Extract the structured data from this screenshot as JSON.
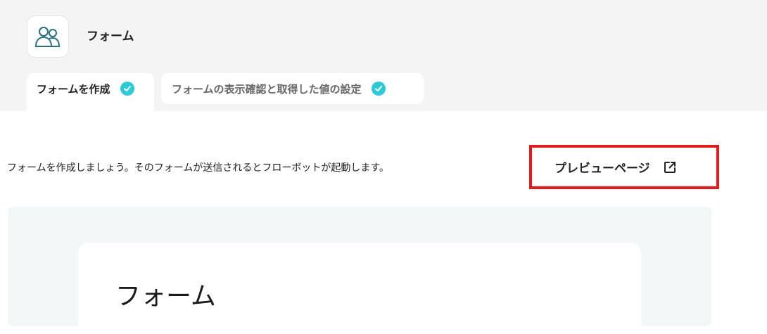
{
  "app": {
    "icon": "users-icon",
    "title": "フォーム"
  },
  "tabs": [
    {
      "label": "フォームを作成",
      "completed": true,
      "active": true
    },
    {
      "label": "フォームの表示確認と取得した値の設定",
      "completed": true,
      "active": false
    }
  ],
  "description": "フォームを作成しましょう。そのフォームが送信されるとフローボットが起動します。",
  "preview_button": {
    "label": "プレビューページ",
    "icon": "external-link-icon"
  },
  "form_preview": {
    "title": "フォーム"
  },
  "colors": {
    "accent": "#2ec9d6",
    "highlight": "#e01b1b",
    "preview_bg": "#f1f7f7",
    "header_bg": "#f4f4f4"
  }
}
